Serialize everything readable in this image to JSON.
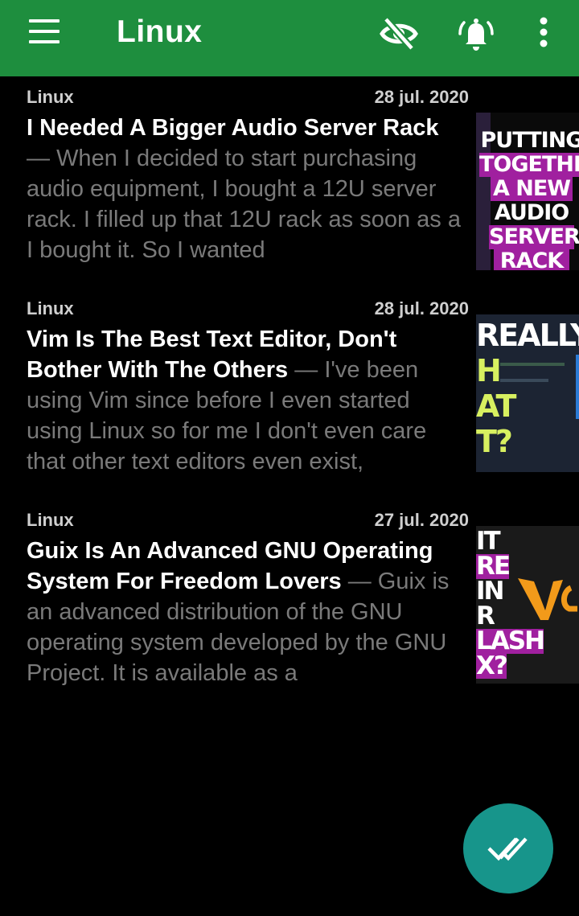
{
  "app_bar": {
    "title": "Linux",
    "icons": [
      "menu-icon",
      "eye-off-icon",
      "notification-bell-icon",
      "more-vert-icon"
    ]
  },
  "articles": [
    {
      "feed": "Linux",
      "date": "28 jul. 2020",
      "title": "I Needed A Bigger Audio Server Rack",
      "separator": " — ",
      "snippet": "When I decided to start purchasing audio equipment, I bought a 12U server rack.  I filled up that 12U rack as soon as a I bought it.  So I wanted",
      "thumb_lines": [
        "PUTTING",
        "TOGETHER",
        "A NEW",
        "AUDIO",
        "SERVER",
        "RACK"
      ]
    },
    {
      "feed": "Linux",
      "date": "28 jul. 2020",
      "title": "Vim Is The Best Text Editor, Don't Bother With The Others",
      "separator": " — ",
      "snippet": "I've been using Vim since before I even started using Linux so for me I don't even care that other text editors even exist,",
      "thumb_lines": [
        "REALLY",
        "H",
        "AT",
        "T?"
      ]
    },
    {
      "feed": "Linux",
      "date": "27 jul. 2020",
      "title": "Guix Is An Advanced GNU Operating System For Freedom Lovers",
      "separator": " — ",
      "snippet": "Guix is an advanced distribution of the GNU operating system developed by the GNU Project. It is available as a",
      "thumb_lines": [
        "IT",
        "RE",
        "IN",
        "R",
        "LASH",
        "X?"
      ]
    }
  ],
  "fab": {
    "icon": "mark-all-read-double-check-icon"
  },
  "colors": {
    "app_bar": "#1e8e3e",
    "fab": "#17958b",
    "thumb_purple": "#a0209f"
  }
}
